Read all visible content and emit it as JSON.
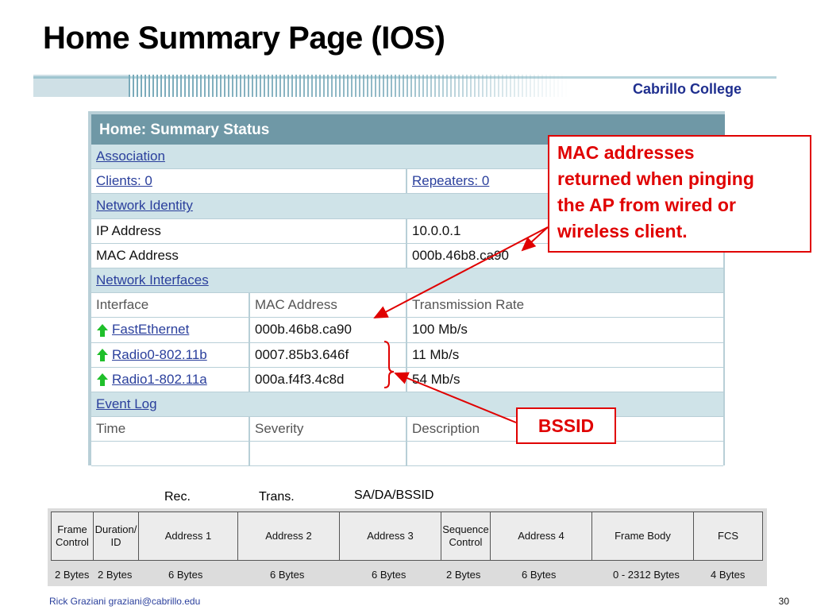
{
  "slide": {
    "title": "Home Summary Page (IOS)"
  },
  "banner": {
    "brand": "Cabrillo College"
  },
  "panel": {
    "title": "Home: Summary Status",
    "association_label": "Association",
    "clients": "Clients: 0",
    "repeaters": "Repeaters: 0",
    "network_identity_label": "Network Identity",
    "ip_label": "IP Address",
    "ip_value": "10.0.0.1",
    "mac_label": "MAC Address",
    "mac_value": "000b.46b8.ca90",
    "network_interfaces_label": "Network Interfaces",
    "if_headers": [
      "Interface",
      "MAC Address",
      "Transmission Rate"
    ],
    "interfaces": [
      {
        "name": "FastEthernet",
        "mac": "000b.46b8.ca90",
        "rate": "100 Mb/s"
      },
      {
        "name": "Radio0-802.11b",
        "mac": "0007.85b3.646f",
        "rate": "11 Mb/s"
      },
      {
        "name": "Radio1-802.11a",
        "mac": "000a.f4f3.4c8d",
        "rate": "54 Mb/s"
      }
    ],
    "event_log_label": "Event Log",
    "event_headers": [
      "Time",
      "Severity",
      "Description"
    ]
  },
  "callouts": {
    "mac_lines": [
      "MAC addresses",
      "returned when pinging",
      "the AP from wired or",
      "wireless client."
    ],
    "bssid": "BSSID"
  },
  "frame_labels": {
    "rec": "Rec.",
    "trans": "Trans.",
    "sa": "SA/DA/BSSID"
  },
  "frame_fields": [
    {
      "lines": [
        "Frame",
        "Control"
      ],
      "bytes": "2 Bytes"
    },
    {
      "lines": [
        "Duration/",
        "ID"
      ],
      "bytes": "2  Bytes"
    },
    {
      "lines": [
        "Address 1"
      ],
      "bytes": "6  Bytes"
    },
    {
      "lines": [
        "Address 2"
      ],
      "bytes": "6  Bytes"
    },
    {
      "lines": [
        "Address 3"
      ],
      "bytes": "6  Bytes"
    },
    {
      "lines": [
        "Sequence",
        "Control"
      ],
      "bytes": "2  Bytes"
    },
    {
      "lines": [
        "Address 4"
      ],
      "bytes": "6  Bytes"
    },
    {
      "lines": [
        "Frame Body"
      ],
      "bytes": "0 - 2312 Bytes"
    },
    {
      "lines": [
        "FCS"
      ],
      "bytes": "4 Bytes"
    }
  ],
  "footer": {
    "author": "Rick Graziani  graziani@cabrillo.edu",
    "page": "30"
  },
  "colors": {
    "accent_red": "#e00000",
    "panel_header": "#6f98a6",
    "link_blue": "#2a3f9c",
    "up_arrow_green": "#1fbf2a"
  }
}
